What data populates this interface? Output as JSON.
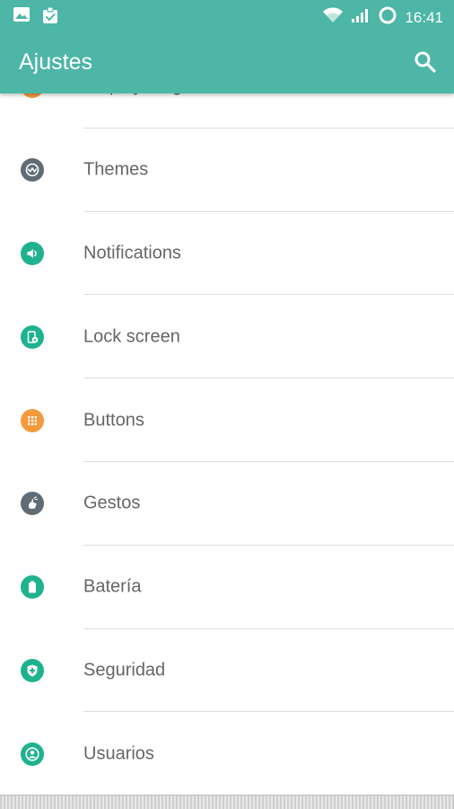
{
  "status_bar": {
    "time": "16:41"
  },
  "app_bar": {
    "title": "Ajustes"
  },
  "colors": {
    "app_bar": "#4db6a6",
    "orange": "#f39a3c",
    "teal": "#1eb28f",
    "gray": "#616b73"
  },
  "settings": [
    {
      "label": "Display & lights",
      "icon": "display-icon",
      "color": "#f39a3c"
    },
    {
      "label": "Themes",
      "icon": "themes-icon",
      "color": "#616b73"
    },
    {
      "label": "Notifications",
      "icon": "notifications-icon",
      "color": "#1eb28f"
    },
    {
      "label": "Lock screen",
      "icon": "lock-screen-icon",
      "color": "#1eb28f"
    },
    {
      "label": "Buttons",
      "icon": "buttons-icon",
      "color": "#f39a3c"
    },
    {
      "label": "Gestos",
      "icon": "gestures-icon",
      "color": "#616b73"
    },
    {
      "label": "Batería",
      "icon": "battery-icon",
      "color": "#1eb28f"
    },
    {
      "label": "Seguridad",
      "icon": "security-icon",
      "color": "#1eb28f"
    },
    {
      "label": "Usuarios",
      "icon": "users-icon",
      "color": "#1eb28f"
    }
  ]
}
